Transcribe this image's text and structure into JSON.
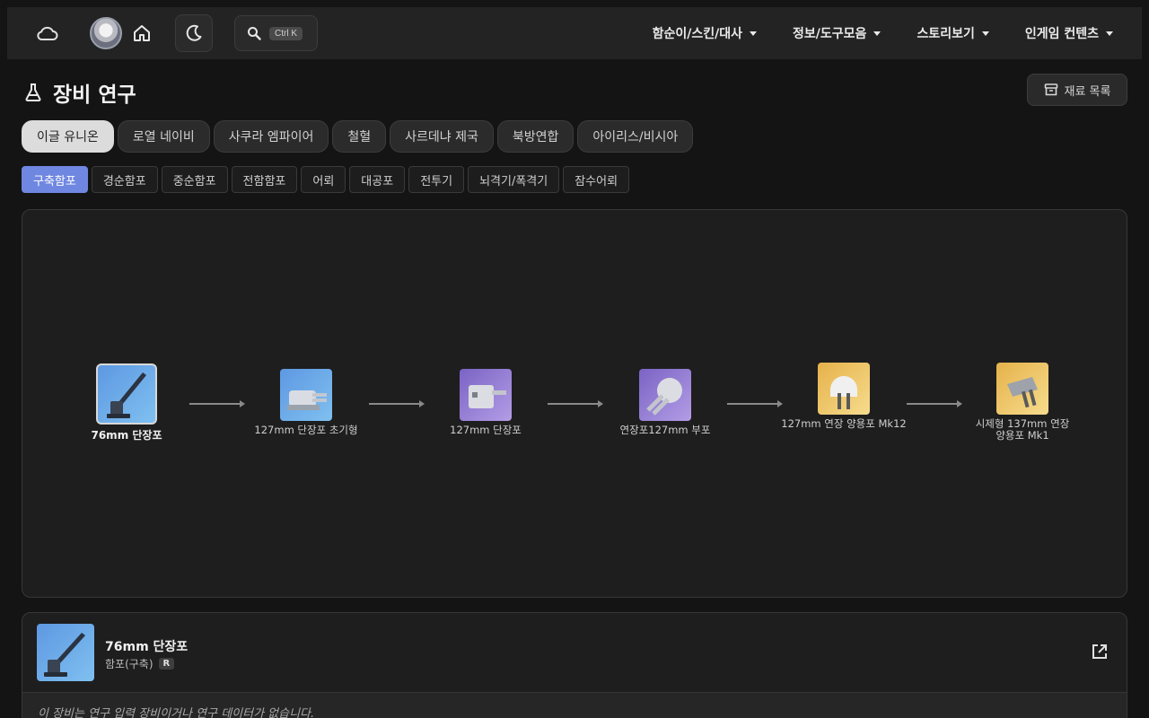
{
  "nav": {
    "search_shortcut": "Ctrl K",
    "menu": [
      {
        "label": "함순이/스킨/대사"
      },
      {
        "label": "정보/도구모음"
      },
      {
        "label": "스토리보기"
      },
      {
        "label": "인게임 컨텐츠"
      }
    ]
  },
  "page": {
    "title": "장비 연구",
    "materials_button": "재료 목록"
  },
  "factions": [
    {
      "label": "이글 유니온",
      "active": true
    },
    {
      "label": "로열 네이비",
      "active": false
    },
    {
      "label": "사쿠라 엠파이어",
      "active": false
    },
    {
      "label": "철혈",
      "active": false
    },
    {
      "label": "사르데냐 제국",
      "active": false
    },
    {
      "label": "북방연합",
      "active": false
    },
    {
      "label": "아이리스/비시아",
      "active": false
    }
  ],
  "categories": [
    {
      "label": "구축함포",
      "active": true
    },
    {
      "label": "경순함포",
      "active": false
    },
    {
      "label": "중순함포",
      "active": false
    },
    {
      "label": "전함함포",
      "active": false
    },
    {
      "label": "어뢰",
      "active": false
    },
    {
      "label": "대공포",
      "active": false
    },
    {
      "label": "전투기",
      "active": false
    },
    {
      "label": "뇌격기/폭격기",
      "active": false
    },
    {
      "label": "잠수어뢰",
      "active": false
    }
  ],
  "tree": {
    "nodes": [
      {
        "label": "76mm 단장포",
        "rarity": "blue",
        "selected": true
      },
      {
        "label": "127mm 단장포 초기형",
        "rarity": "blue",
        "selected": false
      },
      {
        "label": "127mm 단장포",
        "rarity": "purple",
        "selected": false
      },
      {
        "label": "연장포127mm 부포",
        "rarity": "purple",
        "selected": false
      },
      {
        "label": "127mm 연장 양용포 Mk12",
        "rarity": "gold",
        "selected": false
      },
      {
        "label": "시제형 137mm 연장 양용포 Mk1",
        "rarity": "gold",
        "selected": false
      }
    ]
  },
  "detail": {
    "name": "76mm 단장포",
    "type": "함포(구축)",
    "rarity": "R",
    "note": "이 장비는 연구 입력 장비이거나 연구 데이터가 없습니다."
  },
  "colors": {
    "accent": "#6f87e0",
    "rarity_blue": "#6fa9e8",
    "rarity_purple": "#9a82d8",
    "rarity_gold": "#edc466"
  }
}
